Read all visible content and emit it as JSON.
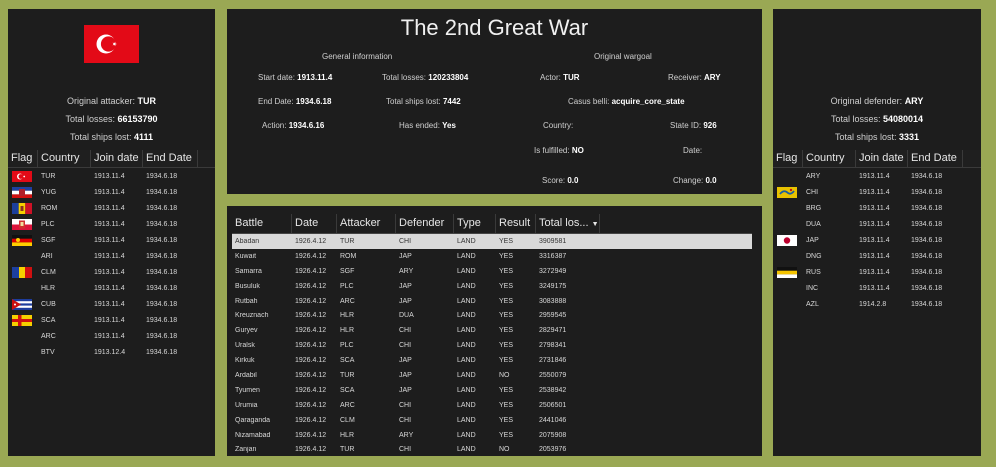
{
  "title": "The 2nd Great War",
  "attacker": {
    "label": "Original attacker:",
    "value": "TUR",
    "losses_label": "Total losses:",
    "losses": "66153790",
    "ships_label": "Total ships lost:",
    "ships": "4111",
    "flag_icon": "turkey-flag-icon"
  },
  "defender": {
    "label": "Original defender:",
    "value": "ARY",
    "losses_label": "Total losses:",
    "losses": "54080014",
    "ships_label": "Total ships lost:",
    "ships": "3331"
  },
  "participant_columns": [
    "Flag",
    "Country",
    "Join date",
    "End Date"
  ],
  "attackers": [
    {
      "flag": "turkey",
      "country": "TUR",
      "join": "1913.11.4",
      "end": "1934.6.18"
    },
    {
      "flag": "yugoslavia",
      "country": "YUG",
      "join": "1913.11.4",
      "end": "1934.6.18"
    },
    {
      "flag": "romania",
      "country": "ROM",
      "join": "1913.11.4",
      "end": "1934.6.18"
    },
    {
      "flag": "plc",
      "country": "PLC",
      "join": "1913.11.4",
      "end": "1934.6.18"
    },
    {
      "flag": "sgf",
      "country": "SGF",
      "join": "1913.11.4",
      "end": "1934.6.18"
    },
    {
      "flag": "",
      "country": "ARI",
      "join": "1913.11.4",
      "end": "1934.6.18"
    },
    {
      "flag": "clm",
      "country": "CLM",
      "join": "1913.11.4",
      "end": "1934.6.18"
    },
    {
      "flag": "",
      "country": "HLR",
      "join": "1913.11.4",
      "end": "1934.6.18"
    },
    {
      "flag": "cuba",
      "country": "CUB",
      "join": "1913.11.4",
      "end": "1934.6.18"
    },
    {
      "flag": "sca",
      "country": "SCA",
      "join": "1913.11.4",
      "end": "1934.6.18"
    },
    {
      "flag": "",
      "country": "ARC",
      "join": "1913.11.4",
      "end": "1934.6.18"
    },
    {
      "flag": "",
      "country": "BTV",
      "join": "1913.12.4",
      "end": "1934.6.18"
    }
  ],
  "defenders": [
    {
      "flag": "",
      "country": "ARY",
      "join": "1913.11.4",
      "end": "1934.6.18"
    },
    {
      "flag": "china",
      "country": "CHI",
      "join": "1913.11.4",
      "end": "1934.6.18"
    },
    {
      "flag": "",
      "country": "BRG",
      "join": "1913.11.4",
      "end": "1934.6.18"
    },
    {
      "flag": "",
      "country": "DUA",
      "join": "1913.11.4",
      "end": "1934.6.18"
    },
    {
      "flag": "japan",
      "country": "JAP",
      "join": "1913.11.4",
      "end": "1934.6.18"
    },
    {
      "flag": "",
      "country": "DNG",
      "join": "1913.11.4",
      "end": "1934.6.18"
    },
    {
      "flag": "russia",
      "country": "RUS",
      "join": "1913.11.4",
      "end": "1934.6.18"
    },
    {
      "flag": "",
      "country": "INC",
      "join": "1913.11.4",
      "end": "1934.6.18"
    },
    {
      "flag": "",
      "country": "AZL",
      "join": "1914.2.8",
      "end": "1934.6.18"
    }
  ],
  "general": {
    "heading": "General information",
    "start_label": "Start date:",
    "start": "1913.11.4",
    "end_label": "End Date:",
    "end": "1934.6.18",
    "action_label": "Action:",
    "action": "1934.6.16",
    "losses_label": "Total losses:",
    "losses": "120233804",
    "ships_label": "Total ships lost:",
    "ships": "7442",
    "ended_label": "Has ended:",
    "ended": "Yes"
  },
  "wargoal": {
    "heading": "Original wargoal",
    "actor_label": "Actor:",
    "actor": "TUR",
    "receiver_label": "Receiver:",
    "receiver": "ARY",
    "casus_label": "Casus belli:",
    "casus": "acquire_core_state",
    "country_label": "Country:",
    "country": "",
    "state_label": "State ID:",
    "state": "926",
    "fulfilled_label": "Is fulfilled:",
    "fulfilled": "NO",
    "date_label": "Date:",
    "date": "",
    "score_label": "Score:",
    "score": "0.0",
    "change_label": "Change:",
    "change": "0.0"
  },
  "battle_columns": [
    "Battle",
    "Date",
    "Attacker",
    "Defender",
    "Type",
    "Result",
    "Total los..."
  ],
  "sort_icon": "sort-desc-icon",
  "battles": [
    [
      "Abadan",
      "1926.4.12",
      "TUR",
      "CHI",
      "LAND",
      "YES",
      "3909581"
    ],
    [
      "Kuwait",
      "1926.4.12",
      "ROM",
      "JAP",
      "LAND",
      "YES",
      "3316387"
    ],
    [
      "Samarra",
      "1926.4.12",
      "SGF",
      "ARY",
      "LAND",
      "YES",
      "3272949"
    ],
    [
      "Busuluk",
      "1926.4.12",
      "PLC",
      "JAP",
      "LAND",
      "YES",
      "3249175"
    ],
    [
      "Rutbah",
      "1926.4.12",
      "ARC",
      "JAP",
      "LAND",
      "YES",
      "3083888"
    ],
    [
      "Kreuznach",
      "1926.4.12",
      "HLR",
      "DUA",
      "LAND",
      "YES",
      "2959545"
    ],
    [
      "Guryev",
      "1926.4.12",
      "HLR",
      "CHI",
      "LAND",
      "YES",
      "2829471"
    ],
    [
      "Uralsk",
      "1926.4.12",
      "PLC",
      "CHI",
      "LAND",
      "YES",
      "2798341"
    ],
    [
      "Kirkuk",
      "1926.4.12",
      "SCA",
      "JAP",
      "LAND",
      "YES",
      "2731846"
    ],
    [
      "Ardabil",
      "1926.4.12",
      "TUR",
      "JAP",
      "LAND",
      "NO",
      "2550079"
    ],
    [
      "Tyumen",
      "1926.4.12",
      "SCA",
      "JAP",
      "LAND",
      "YES",
      "2538942"
    ],
    [
      "Urumia",
      "1926.4.12",
      "ARC",
      "CHI",
      "LAND",
      "YES",
      "2506501"
    ],
    [
      "Qaraganda",
      "1926.4.12",
      "CLM",
      "CHI",
      "LAND",
      "YES",
      "2441046"
    ],
    [
      "Nizamabad",
      "1926.4.12",
      "HLR",
      "ARY",
      "LAND",
      "YES",
      "2075908"
    ],
    [
      "Zanjan",
      "1926.4.12",
      "TUR",
      "CHI",
      "LAND",
      "NO",
      "2053976"
    ]
  ],
  "colors": {
    "background": "#9aa854",
    "panel": "#1d1d1d",
    "selected_row": "#d9d9d9"
  }
}
